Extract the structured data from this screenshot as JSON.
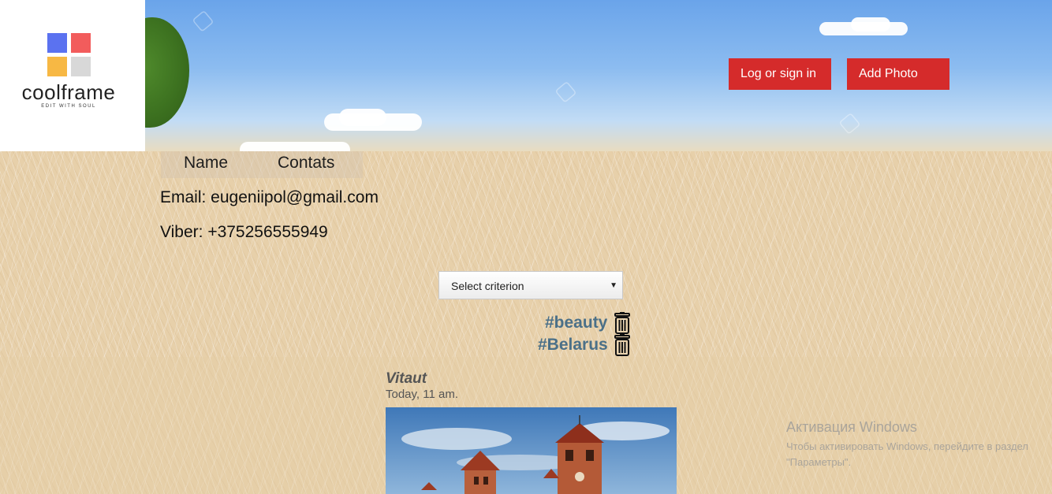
{
  "header": {
    "logo": {
      "name": "coolframe",
      "tagline": "EDIT WITH SOUL"
    },
    "buttons": {
      "login": "Log or sign in",
      "add_photo": "Add Photo"
    },
    "colors": {
      "button_bg": "#d52b2b",
      "logo_blue": "#5b72f0",
      "logo_red": "#f25c5c",
      "logo_yellow": "#f7b844",
      "logo_gray": "#d8d8d8"
    }
  },
  "nav": {
    "items": [
      "Name",
      "Contats"
    ]
  },
  "contacts": {
    "email": "Email: eugeniipol@gmail.com",
    "viber": "Viber: +375256555949"
  },
  "filter": {
    "select_value": "Select criterion"
  },
  "tags": [
    {
      "label": "#beauty",
      "icon": "trash-icon"
    },
    {
      "label": "#Belarus",
      "icon": "trash-icon"
    }
  ],
  "post": {
    "author": "Vitaut",
    "time": "Today, 11 am."
  },
  "os_overlay": {
    "title": "Активация Windows",
    "subtitle": "Чтобы активировать Windows, перейдите в раздел \"Параметры\"."
  }
}
